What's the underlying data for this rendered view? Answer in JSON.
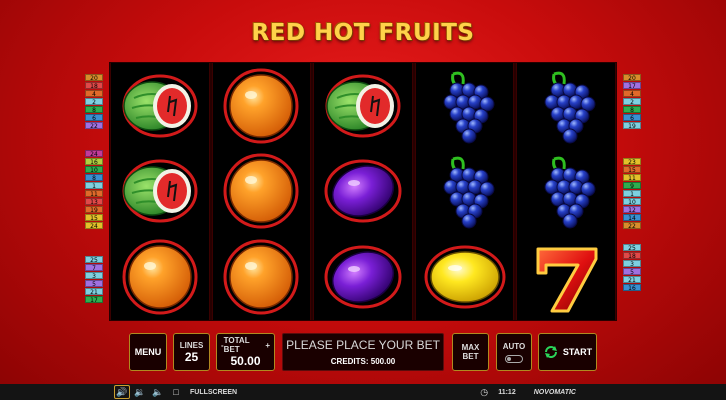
{
  "game": {
    "title": "RED HOT FRUITS"
  },
  "reels": [
    [
      "watermelon",
      "watermelon",
      "orange"
    ],
    [
      "orange",
      "orange",
      "orange"
    ],
    [
      "watermelon",
      "plum",
      "plum"
    ],
    [
      "grapes",
      "grapes",
      "lemon"
    ],
    [
      "grapes",
      "grapes",
      "seven"
    ]
  ],
  "paylines": {
    "left_top": [
      "20",
      "18",
      "4",
      "2",
      "8",
      "6",
      "22"
    ],
    "left_middle": [
      "24",
      "16",
      "10",
      "8",
      "1",
      "11",
      "13",
      "19",
      "15",
      "24"
    ],
    "left_bottom": [
      "25",
      "7",
      "3",
      "5",
      "21",
      "17"
    ],
    "right_top": [
      "20",
      "17",
      "4",
      "2",
      "8",
      "6",
      "19"
    ],
    "right_middle": [
      "23",
      "15",
      "11",
      "9",
      "1",
      "10",
      "12",
      "14",
      "22"
    ],
    "right_bottom": [
      "25",
      "18",
      "3",
      "5",
      "21",
      "16"
    ]
  },
  "controls": {
    "menu_label": "MENU",
    "lines_label": "LINES",
    "lines_value": "25",
    "total_bet_label": "TOTAL BET",
    "total_bet_minus": "-",
    "total_bet_plus": "+",
    "total_bet_value": "50.00",
    "message": "PLEASE PLACE YOUR BET",
    "credits_text": "CREDITS: 500.00",
    "max_bet_line1": "MAX",
    "max_bet_line2": "BET",
    "auto_label": "AUTO",
    "start_label": "START"
  },
  "statusbar": {
    "fullscreen_label": "FULLSCREEN",
    "time": "11:12",
    "brand": "NOVOMATIC"
  },
  "colors": {
    "accent_gold": "#b08a20",
    "start_green": "#2bd45a",
    "background_red": "#d01010"
  },
  "icons": {
    "sound": "speaker-icon",
    "volume": "volume-icon",
    "mute": "mute-icon",
    "fullscreen": "fullscreen-icon",
    "clock": "clock-icon",
    "start": "refresh-arrows-icon"
  }
}
